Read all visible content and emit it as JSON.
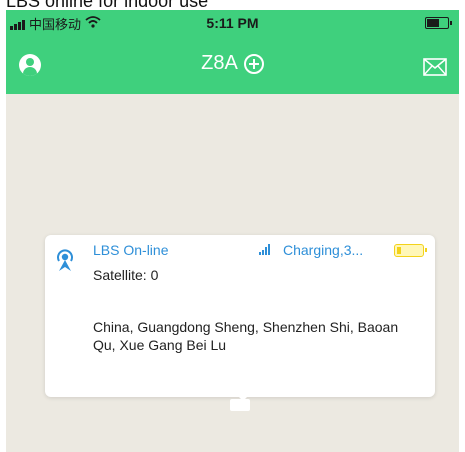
{
  "caption": "LBS online for indoor use",
  "status_bar": {
    "carrier": "中国移动",
    "time": "5:11 PM"
  },
  "navbar": {
    "title": "Z8A"
  },
  "device_card": {
    "location_status": "LBS On-line",
    "power_status": "Charging,3...",
    "satellite": "Satellite: 0",
    "address": "China, Guangdong Sheng, Shenzhen Shi, Baoan Qu, Xue Gang Bei Lu"
  },
  "colors": {
    "accent_green": "#3fd07d",
    "link_blue": "#2e8fd8",
    "battery_yellow": "#f3d21a",
    "map_background": "#ece9e1"
  }
}
